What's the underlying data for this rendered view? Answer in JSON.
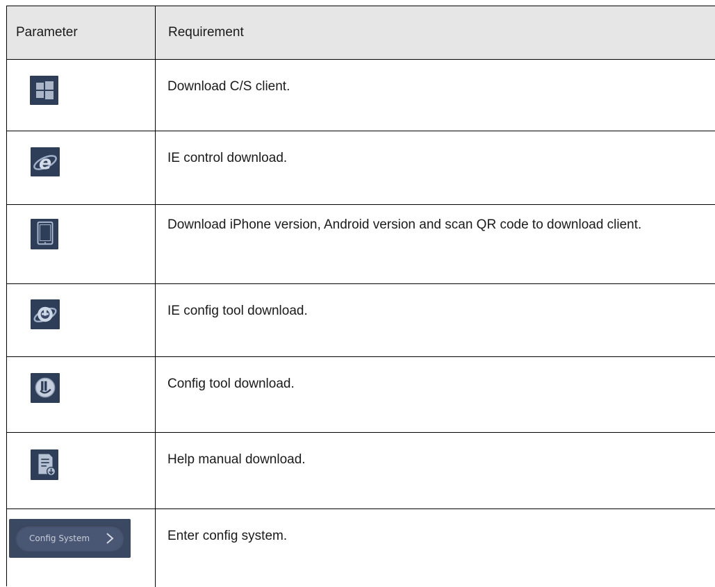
{
  "table": {
    "headers": {
      "parameter": "Parameter",
      "requirement": "Requirement"
    },
    "rows": [
      {
        "icon": "windows-icon",
        "requirement": "Download C/S client."
      },
      {
        "icon": "ie-browser-icon",
        "requirement": "IE control download."
      },
      {
        "icon": "mobile-phone-icon",
        "requirement": "Download iPhone version, Android version and scan QR code to download client."
      },
      {
        "icon": "ie-config-tool-icon",
        "requirement": "IE config tool download."
      },
      {
        "icon": "config-tool-icon",
        "requirement": "Config tool download."
      },
      {
        "icon": "help-manual-download-icon",
        "requirement": "Help manual download."
      },
      {
        "icon": "chevron-right-icon",
        "button_label": "Config System",
        "requirement": "Enter config system."
      }
    ]
  },
  "colors": {
    "icon_tile": "#2e3e58",
    "icon_glyph": "#c9d2e0",
    "header_bg": "#e6e6e6"
  }
}
